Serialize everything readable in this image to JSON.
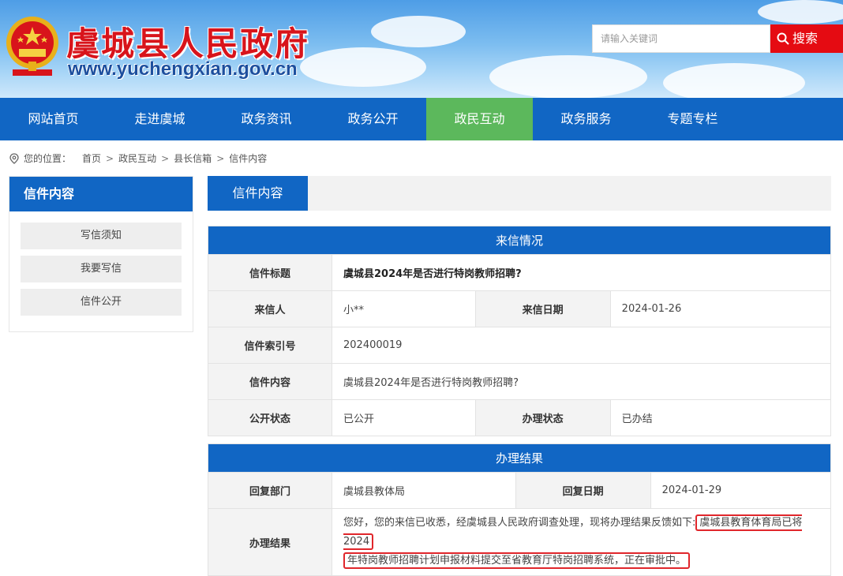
{
  "header": {
    "title": "虞城县人民政府",
    "url": "www.yuchengxian.gov.cn",
    "search_placeholder": "请输入关键词",
    "search_label": "搜索"
  },
  "nav": {
    "items": [
      {
        "label": "网站首页"
      },
      {
        "label": "走进虞城"
      },
      {
        "label": "政务资讯"
      },
      {
        "label": "政务公开"
      },
      {
        "label": "政民互动",
        "active": true
      },
      {
        "label": "政务服务"
      },
      {
        "label": "专题专栏"
      }
    ]
  },
  "breadcrumb": {
    "prefix": "您的位置：",
    "items": [
      "首页",
      "政民互动",
      "县长信箱",
      "信件内容"
    ]
  },
  "sidebar": {
    "title": "信件内容",
    "items": [
      "写信须知",
      "我要写信",
      "信件公开"
    ]
  },
  "main": {
    "tab": "信件内容",
    "letter_section": "来信情况",
    "letter": {
      "title_label": "信件标题",
      "title_value": "虞城县2024年是否进行特岗教师招聘?",
      "sender_label": "来信人",
      "sender_value": "小**",
      "date_label": "来信日期",
      "date_value": "2024-01-26",
      "index_label": "信件索引号",
      "index_value": "202400019",
      "content_label": "信件内容",
      "content_value": "虞城县2024年是否进行特岗教师招聘?",
      "public_label": "公开状态",
      "public_value": "已公开",
      "status_label": "办理状态",
      "status_value": "已办结"
    },
    "result_section": "办理结果",
    "result": {
      "dept_label": "回复部门",
      "dept_value": "虞城县教体局",
      "reply_date_label": "回复日期",
      "reply_date_value": "2024-01-29",
      "result_label": "办理结果",
      "result_intro": "您好，您的来信已收悉，经虞城县人民政府调查处理，现将办理结果反馈如下:",
      "result_highlight_1": "虞城县教育体育局已将2024",
      "result_highlight_2": "年特岗教师招聘计划申报材料提交至省教育厅特岗招聘系统，正在审批中。"
    }
  }
}
